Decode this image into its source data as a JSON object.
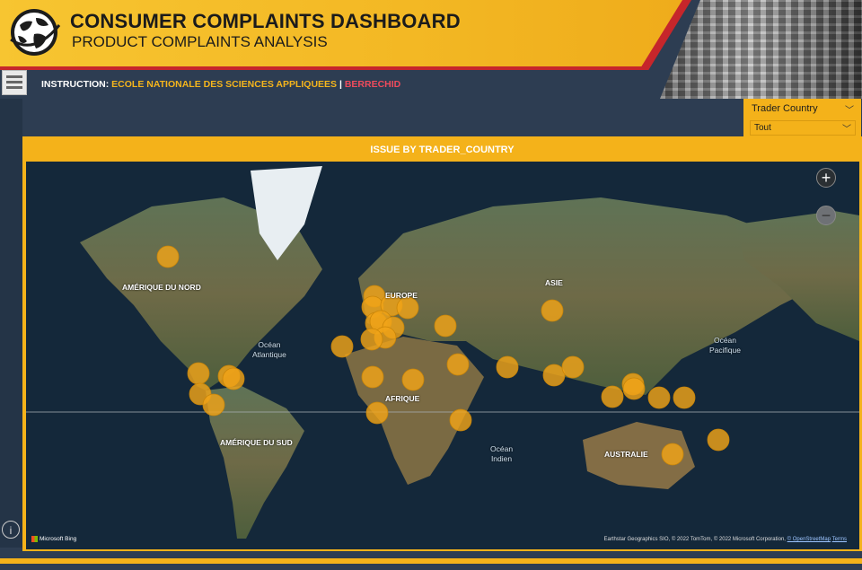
{
  "header": {
    "title": "CONSUMER COMPLAINTS DASHBOARD",
    "subtitle": "PRODUCT COMPLAINTS ANALYSIS",
    "instruction_label": "INSTRUCTION:",
    "school": "ECOLE NATIONALE DES SCIENCES APPLIQUEES",
    "separator": "|",
    "city": "BERRECHID"
  },
  "slicer": {
    "title": "Trader Country",
    "selected": "Tout",
    "chevron": "chevron-down-icon"
  },
  "map": {
    "title": "ISSUE BY TRADER_COUNTRY",
    "continent_labels": [
      "AMÉRIQUE DU NORD",
      "EUROPE",
      "ASIE",
      "AFRIQUE",
      "AMÉRIQUE DU SUD",
      "AUSTRALIE"
    ],
    "ocean_labels": [
      {
        "line1": "Océan",
        "line2": "Atlantique"
      },
      {
        "line1": "Océan",
        "line2": "Pacifique"
      },
      {
        "line1": "Océan",
        "line2": "Indien"
      }
    ],
    "zoom_in_label": "+",
    "zoom_out_label": "−",
    "bing_label": "Microsoft Bing",
    "attribution": "Earthstar Geographics SIO, © 2022 TomTom, © 2022 Microsoft Corporation,",
    "osm_link": "© OpenStreetMap",
    "terms_link": "Terms",
    "bubble_color": "#f0a318"
  },
  "colors": {
    "accent_yellow": "#f4b21a",
    "accent_red": "#c6262b",
    "background": "#2d3d52"
  },
  "info_icon": "i"
}
